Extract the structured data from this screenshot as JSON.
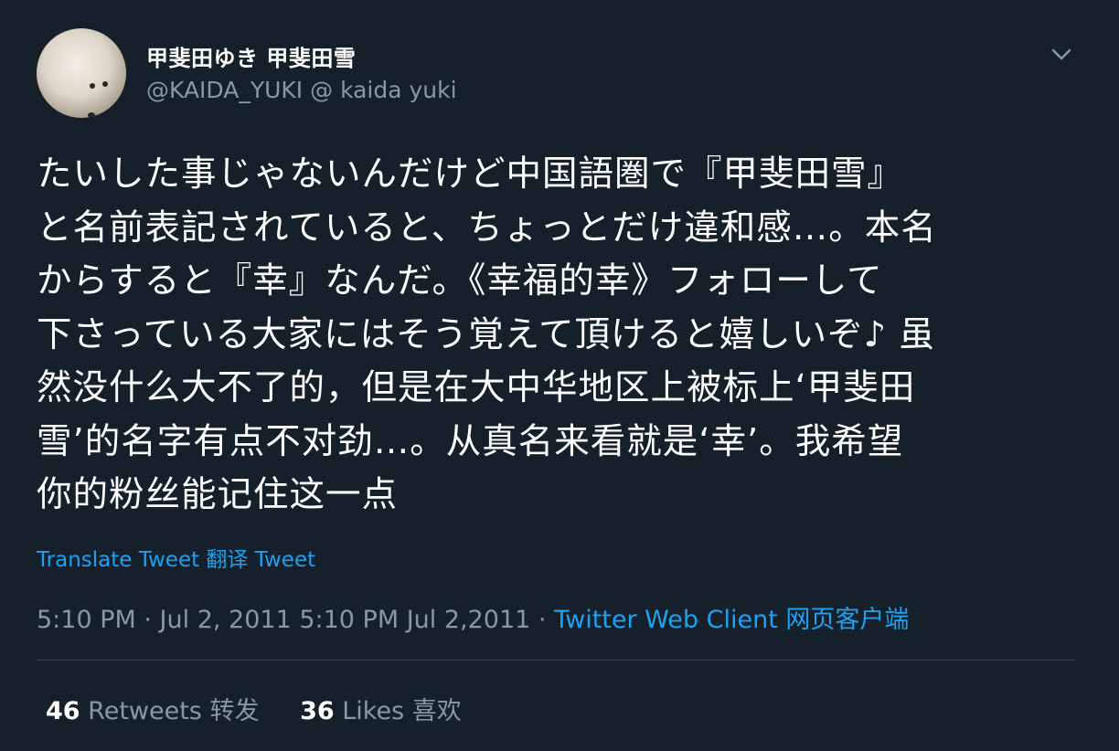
{
  "user": {
    "display_name": "甲斐田ゆき 甲斐田雪",
    "handle": "@KAIDA_YUKI @ kaida yuki",
    "avatar_icon": "white-dog-avatar"
  },
  "tweet": {
    "text": "たいした事じゃないんだけど中国語圏で『甲斐田雪』\nと名前表記されていると、ちょっとだけ違和感…。本名\nからすると『幸』なんだ。《幸福的幸》フォローして\n下さっている大家にはそう覚えて頂けると嬉しいぞ♪ 虽\n然没什么大不了的，但是在大中华地区上被标上‘甲斐田\n雪’的名字有点不对劲…。从真名来看就是‘幸’。我希望\n你的粉丝能记住这一点",
    "translate_label": "Translate Tweet 翻译 Tweet",
    "timestamp": "5:10 PM · Jul 2, 2011 5:10 PM Jul 2,2011",
    "separator": " · ",
    "source": "Twitter Web Client 网页客户端"
  },
  "stats": {
    "retweets_count": "46",
    "retweets_label": "Retweets 转发",
    "likes_count": "36",
    "likes_label": "Likes 喜欢"
  },
  "colors": {
    "background": "#15202b",
    "text": "#ffffff",
    "secondary": "#8899a6",
    "link": "#1da1f2",
    "divider": "#38444d"
  }
}
